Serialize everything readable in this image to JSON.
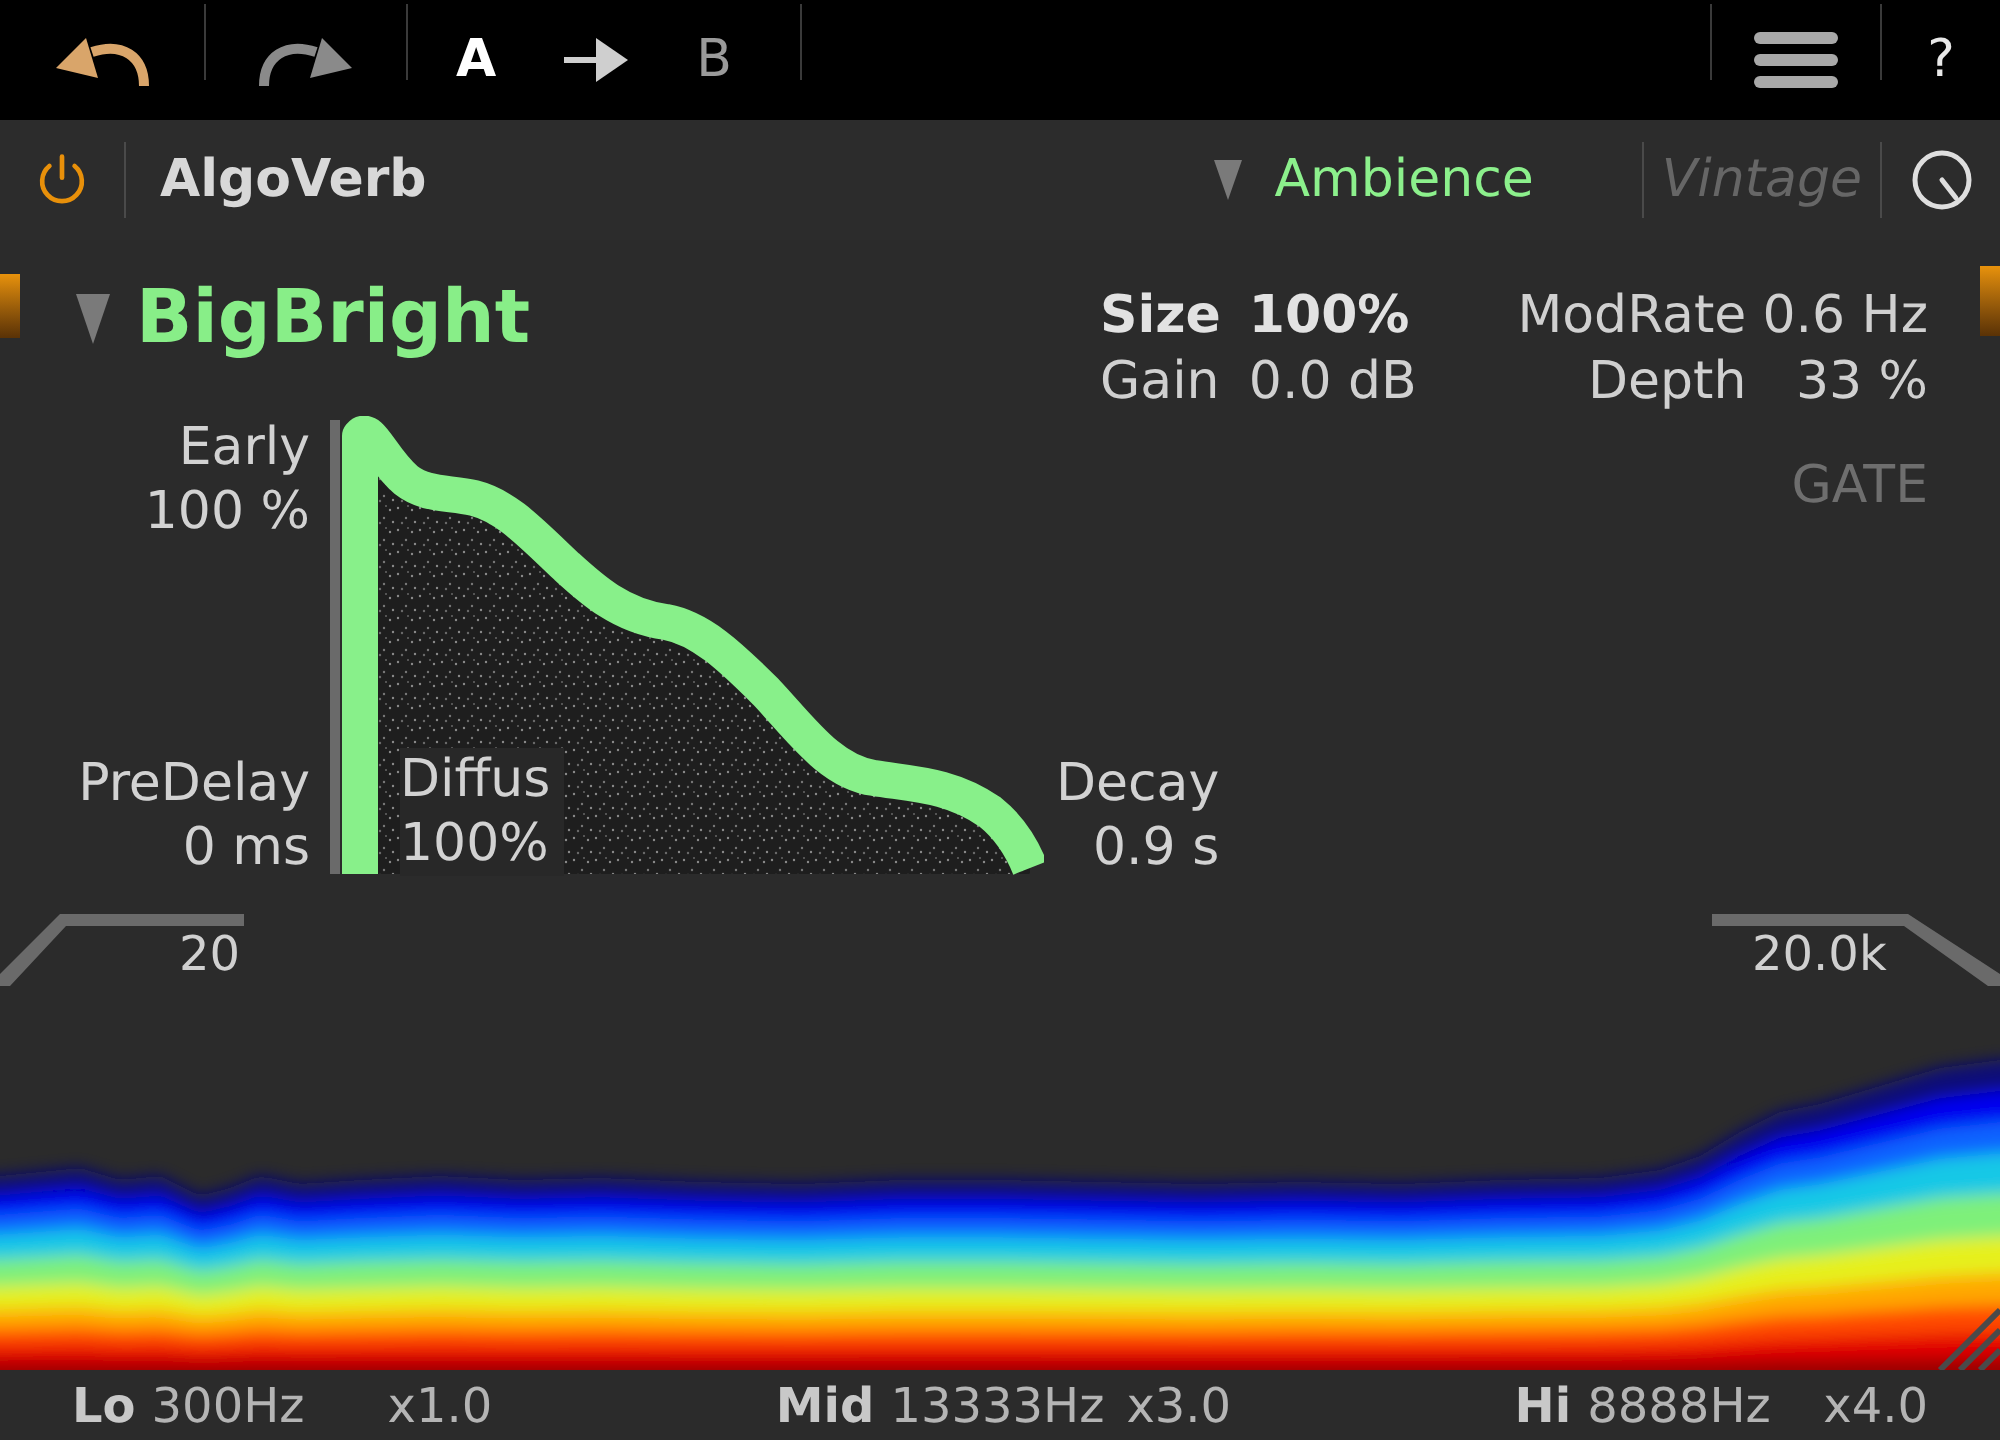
{
  "toolbar": {
    "history": [
      {
        "kind": "undo",
        "enabled": true
      },
      {
        "kind": "redo",
        "enabled": false
      }
    ],
    "compare": [
      {
        "label": "A",
        "selected": true
      },
      {
        "label": "B",
        "selected": false
      }
    ],
    "help": "?"
  },
  "header": {
    "power": {
      "on": true
    },
    "plugin_name": "AlgoVerb",
    "category": "Ambience",
    "style": {
      "label": "Vintage",
      "enabled": false
    }
  },
  "preset": {
    "name": "BigBright"
  },
  "param_columns": [
    {
      "params": [
        {
          "label": "Size",
          "value": "100%",
          "selected": true
        },
        {
          "label": "Gain",
          "value": "0.0 dB",
          "selected": false
        }
      ]
    },
    {
      "params": [
        {
          "label": "ModRate",
          "value": "0.6 Hz",
          "selected": false
        },
        {
          "label": "Depth",
          "value": "33 %",
          "selected": false
        }
      ]
    }
  ],
  "gate": {
    "label": "GATE",
    "on": false
  },
  "envelope": {
    "early": {
      "label": "Early",
      "value": "100 %"
    },
    "predelay": {
      "label": "PreDelay",
      "value": "0 ms"
    },
    "diffusion": {
      "label": "Diffus",
      "value": "100%"
    },
    "decay": {
      "label": "Decay",
      "value": "0.9 s"
    }
  },
  "filter": {
    "low_cut": "20",
    "high_cut": "20.0k"
  },
  "bands": [
    {
      "label": "Lo",
      "frequency": "300Hz",
      "factor": "x1.0"
    },
    {
      "label": "Mid",
      "frequency": "13333Hz",
      "factor": "x3.0"
    },
    {
      "label": "Hi",
      "frequency": "8888Hz",
      "factor": "x4.0"
    }
  ]
}
